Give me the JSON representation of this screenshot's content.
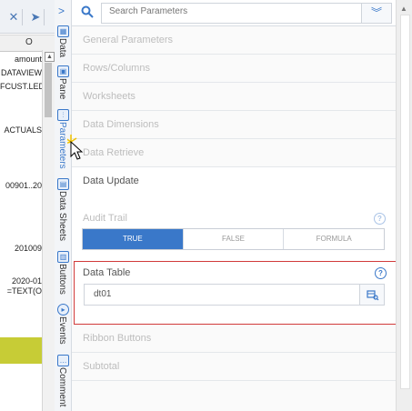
{
  "sheet": {
    "column_header": "O",
    "cells": [
      "amount",
      "DATAVIEW",
      "FCUST.LED",
      "ACTUALS",
      "00901..20",
      "201009",
      "2020-01",
      "=TEXT(O"
    ]
  },
  "rail": {
    "tabs": [
      {
        "label": "Data",
        "icon": "data-icon"
      },
      {
        "label": "Pane",
        "icon": "pane-icon"
      },
      {
        "label": "Parameters",
        "icon": "parameters-icon"
      },
      {
        "label": "Data Sheets",
        "icon": "data-sheets-icon"
      },
      {
        "label": "Buttons",
        "icon": "buttons-icon"
      },
      {
        "label": "Events",
        "icon": "events-icon"
      },
      {
        "label": "Comment",
        "icon": "comment-icon"
      }
    ]
  },
  "search": {
    "placeholder": "Search Parameters"
  },
  "sections": {
    "general": "General Parameters",
    "rows_columns": "Rows/Columns",
    "worksheets": "Worksheets",
    "data_dimensions": "Data Dimensions",
    "data_retrieve": "Data Retrieve",
    "data_update": "Data Update",
    "ribbon_buttons": "Ribbon Buttons",
    "subtotal": "Subtotal"
  },
  "data_update": {
    "audit_trail_label": "Audit Trail",
    "audit_options": [
      "TRUE",
      "FALSE",
      "FORMULA"
    ],
    "audit_selected": "TRUE",
    "data_table_label": "Data Table",
    "data_table_value": "dt01"
  },
  "colors": {
    "accent": "#3a78c9",
    "highlight_border": "#d13a3a",
    "row_highlight": "#c7cc36"
  }
}
